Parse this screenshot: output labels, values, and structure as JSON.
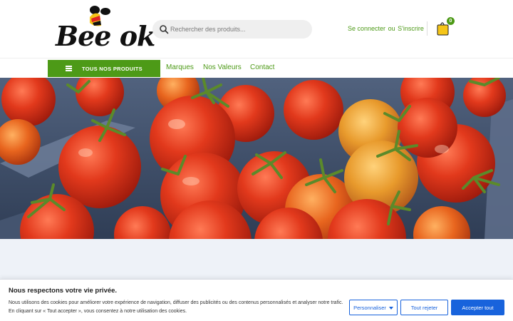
{
  "header": {
    "logo_text": "Bee ok",
    "search": {
      "placeholder": "Rechercher des produits..."
    },
    "account": {
      "login": "Se connecter",
      "or": "ou",
      "register": "S'inscrire"
    },
    "cart": {
      "count": "0",
      "icon": "shopping-bag-icon"
    }
  },
  "nav": {
    "all_products": "TOUS NOS PRODUITS",
    "links": [
      "Marques",
      "Nos Valeurs",
      "Contact"
    ]
  },
  "hero": {
    "image": "tomatoes-in-crates"
  },
  "cookie": {
    "title": "Nous respectons votre vie privée.",
    "text": "Nous utilisons des cookies pour améliorer votre expérience de navigation, diffuser des publicités ou des contenus personnalisés et analyser notre trafic. En cliquant sur « Tout accepter », vous consentez à notre utilisation des cookies.",
    "customize": "Personnaliser",
    "reject": "Tout rejeter",
    "accept": "Accepter tout"
  },
  "colors": {
    "brand_green": "#4d9a17",
    "cart_yellow": "#f5c518",
    "cookie_blue": "#1863dc",
    "background_light": "#eef2f8"
  }
}
